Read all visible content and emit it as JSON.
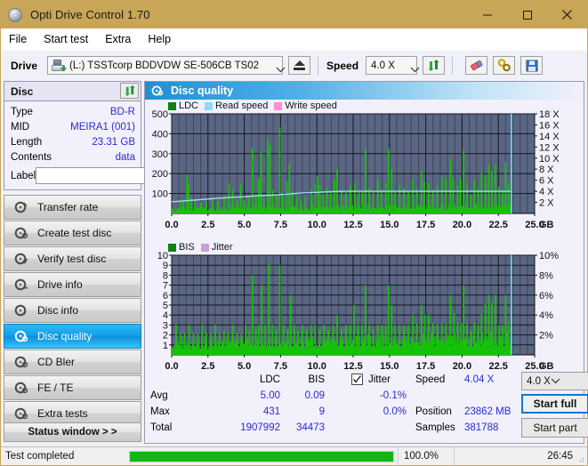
{
  "window": {
    "title": "Opti Drive Control 1.70",
    "icon": "disc-icon",
    "minimize": "−",
    "maximize": "□",
    "close": "✕"
  },
  "menu": [
    "File",
    "Start test",
    "Extra",
    "Help"
  ],
  "toolbar": {
    "drive_label": "Drive",
    "drive_value": "(L:)   TSSTcorp BDDVDW SE-506CB TS02",
    "eject_icon": "eject-icon",
    "speed_label": "Speed",
    "speed_value": "4.0 X",
    "refresh_icon": "refresh-icon",
    "erase_icon": "eraser-icon",
    "tools_icon": "tools-icon",
    "save_icon": "save-icon"
  },
  "disc": {
    "header": "Disc",
    "refresh_icon": "refresh-disc-icon",
    "fields": [
      {
        "key": "Type",
        "value": "BD-R"
      },
      {
        "key": "MID",
        "value": "MEIRA1 (001)"
      },
      {
        "key": "Length",
        "value": "23.31 GB"
      },
      {
        "key": "Contents",
        "value": "data"
      }
    ],
    "label_key": "Label",
    "label_value": "",
    "label_placeholder": "",
    "label_button_icon": "cd-icon"
  },
  "nav": {
    "items": [
      {
        "label": "Transfer rate",
        "icon": "disc-test-icon",
        "active": false
      },
      {
        "label": "Create test disc",
        "icon": "disc-test-icon",
        "active": false
      },
      {
        "label": "Verify test disc",
        "icon": "disc-test-icon",
        "active": false
      },
      {
        "label": "Drive info",
        "icon": "disc-test-icon",
        "active": false
      },
      {
        "label": "Disc info",
        "icon": "disc-test-icon",
        "active": false
      },
      {
        "label": "Disc quality",
        "icon": "disc-test-icon",
        "active": true
      },
      {
        "label": "CD Bler",
        "icon": "disc-test-icon",
        "active": false
      },
      {
        "label": "FE / TE",
        "icon": "disc-test-icon",
        "active": false
      },
      {
        "label": "Extra tests",
        "icon": "disc-test-icon",
        "active": false
      }
    ],
    "status_window": "Status window > >"
  },
  "panel": {
    "title": "Disc quality",
    "icon": "disc-quality-icon"
  },
  "stats": {
    "col_ldc": "LDC",
    "col_bis": "BIS",
    "jitter_label": "Jitter",
    "jitter_checked": true,
    "rows": [
      {
        "name": "Avg",
        "ldc": "5.00",
        "bis": "0.09",
        "jitter": "-0.1%"
      },
      {
        "name": "Max",
        "ldc": "431",
        "bis": "9",
        "jitter": "0.0%"
      },
      {
        "name": "Total",
        "ldc": "1907992",
        "bis": "34473",
        "jitter": ""
      }
    ],
    "speed_key": "Speed",
    "speed_val": "4.04 X",
    "position_key": "Position",
    "position_val": "23862 MB",
    "samples_key": "Samples",
    "samples_val": "381788",
    "speed_select": "4.0 X",
    "start_full": "Start full",
    "start_part": "Start part"
  },
  "statusbar": {
    "text": "Test completed",
    "percent_label": "100.0%",
    "percent_value": 100,
    "time": "26:45"
  },
  "colors": {
    "title_bar": "#c8a557",
    "accent_blue": "#1277d4",
    "chart_bg": "#5a6684",
    "ldc_green": "#16c209",
    "read_speed": "#8fd8f7",
    "write_speed": "#f48fd8",
    "jitter": "#c8a0d8",
    "progress_green": "#12b512",
    "value_blue": "#2b2bd0",
    "nav_active": "#14a0e8"
  },
  "chart_data": [
    {
      "type": "bar",
      "name": "ldc-chart",
      "title": "",
      "xlabel": "GB",
      "ylabel": "",
      "xlim": [
        0,
        25
      ],
      "ylim": [
        0,
        500
      ],
      "xticks": [
        "0.0",
        "2.5",
        "5.0",
        "7.5",
        "10.0",
        "12.5",
        "15.0",
        "17.5",
        "20.0",
        "22.5",
        "25.0"
      ],
      "yticks": [
        100,
        200,
        300,
        400,
        500
      ],
      "y2lim": [
        0,
        18
      ],
      "y2ticks": [
        "2 X",
        "4 X",
        "6 X",
        "8 X",
        "10 X",
        "12 X",
        "14 X",
        "16 X",
        "18 X"
      ],
      "grid": true,
      "legend": [
        {
          "label": "LDC",
          "color": "#108010"
        },
        {
          "label": "Read speed",
          "color": "#8fd8f7"
        },
        {
          "label": "Write speed",
          "color": "#f48fd8"
        }
      ],
      "data_end_gb": 23.4,
      "baseline": 30,
      "spikes": [
        [
          0.55,
          60
        ],
        [
          0.8,
          70
        ],
        [
          1.05,
          195
        ],
        [
          1.15,
          150
        ],
        [
          1.35,
          80
        ],
        [
          1.6,
          65
        ],
        [
          2.0,
          55
        ],
        [
          2.4,
          60
        ],
        [
          2.8,
          70
        ],
        [
          3.2,
          62
        ],
        [
          3.6,
          88
        ],
        [
          3.95,
          150
        ],
        [
          4.2,
          120
        ],
        [
          4.5,
          72
        ],
        [
          4.75,
          150
        ],
        [
          5.0,
          70
        ],
        [
          5.3,
          85
        ],
        [
          5.55,
          330
        ],
        [
          5.8,
          95
        ],
        [
          6.0,
          175
        ],
        [
          6.15,
          305
        ],
        [
          6.35,
          80
        ],
        [
          6.6,
          380
        ],
        [
          6.75,
          345
        ],
        [
          6.95,
          120
        ],
        [
          7.25,
          95
        ],
        [
          7.45,
          432
        ],
        [
          7.6,
          105
        ],
        [
          7.95,
          160
        ],
        [
          8.1,
          252
        ],
        [
          8.3,
          110
        ],
        [
          8.6,
          95
        ],
        [
          8.9,
          70
        ],
        [
          9.2,
          78
        ],
        [
          9.6,
          120
        ],
        [
          9.9,
          150
        ],
        [
          10.05,
          188
        ],
        [
          10.2,
          142
        ],
        [
          10.45,
          100
        ],
        [
          10.7,
          130
        ],
        [
          10.95,
          112
        ],
        [
          11.2,
          170
        ],
        [
          11.4,
          225
        ],
        [
          11.7,
          120
        ],
        [
          12.0,
          105
        ],
        [
          12.3,
          140
        ],
        [
          12.6,
          152
        ],
        [
          12.9,
          105
        ],
        [
          13.15,
          118
        ],
        [
          13.35,
          322
        ],
        [
          13.6,
          128
        ],
        [
          13.9,
          105
        ],
        [
          14.2,
          175
        ],
        [
          14.45,
          120
        ],
        [
          14.75,
          150
        ],
        [
          14.95,
          325
        ],
        [
          15.15,
          222
        ],
        [
          15.4,
          112
        ],
        [
          15.7,
          140
        ],
        [
          16.0,
          128
        ],
        [
          16.3,
          112
        ],
        [
          16.6,
          172
        ],
        [
          16.9,
          125
        ],
        [
          17.2,
          215
        ],
        [
          17.4,
          160
        ],
        [
          17.7,
          150
        ],
        [
          18.0,
          120
        ],
        [
          18.3,
          140
        ],
        [
          18.6,
          188
        ],
        [
          18.9,
          178
        ],
        [
          19.2,
          270
        ],
        [
          19.4,
          182
        ],
        [
          19.7,
          140
        ],
        [
          19.9,
          172
        ],
        [
          20.1,
          318
        ],
        [
          20.35,
          145
        ],
        [
          20.6,
          95
        ],
        [
          20.85,
          172
        ],
        [
          21.1,
          126
        ],
        [
          21.35,
          205
        ],
        [
          21.6,
          190
        ],
        [
          21.85,
          245
        ],
        [
          22.05,
          212
        ],
        [
          22.3,
          248
        ],
        [
          22.55,
          135
        ],
        [
          22.8,
          120
        ],
        [
          23.0,
          258
        ],
        [
          23.2,
          150
        ]
      ],
      "read_speed_line": [
        [
          0.0,
          2.1
        ],
        [
          1.0,
          2.3
        ],
        [
          2.0,
          2.5
        ],
        [
          3.0,
          2.7
        ],
        [
          4.0,
          2.9
        ],
        [
          5.0,
          3.0
        ],
        [
          6.0,
          3.2
        ],
        [
          7.0,
          3.3
        ],
        [
          8.0,
          3.5
        ],
        [
          9.0,
          3.7
        ],
        [
          10.0,
          3.8
        ],
        [
          11.0,
          3.95
        ],
        [
          12.0,
          4.0
        ],
        [
          14.0,
          4.0
        ],
        [
          18.0,
          4.0
        ],
        [
          23.4,
          4.0
        ]
      ],
      "end_marker_gb": 23.4
    },
    {
      "type": "bar",
      "name": "bis-chart",
      "title": "",
      "xlabel": "GB",
      "ylabel": "",
      "xlim": [
        0,
        25
      ],
      "ylim": [
        0,
        10
      ],
      "xticks": [
        "0.0",
        "2.5",
        "5.0",
        "7.5",
        "10.0",
        "12.5",
        "15.0",
        "17.5",
        "20.0",
        "22.5",
        "25.0"
      ],
      "yticks": [
        1,
        2,
        3,
        4,
        5,
        6,
        7,
        8,
        9,
        10
      ],
      "y2lim": [
        0,
        10
      ],
      "y2ticks": [
        "2%",
        "4%",
        "6%",
        "8%",
        "10%"
      ],
      "grid": true,
      "legend": [
        {
          "label": "BIS",
          "color": "#108010"
        },
        {
          "label": "Jitter",
          "color": "#c8a0d8"
        }
      ],
      "data_end_gb": 23.4,
      "baseline": 1.4,
      "spikes": [
        [
          0.3,
          3.0
        ],
        [
          0.6,
          2.1
        ],
        [
          0.9,
          2.2
        ],
        [
          1.2,
          3.0
        ],
        [
          1.5,
          2.2
        ],
        [
          1.8,
          2.1
        ],
        [
          2.1,
          3.0
        ],
        [
          2.4,
          2.2
        ],
        [
          2.7,
          2.1
        ],
        [
          3.0,
          3.0
        ],
        [
          3.3,
          2.2
        ],
        [
          3.6,
          2.4
        ],
        [
          3.9,
          2.2
        ],
        [
          4.2,
          3.0
        ],
        [
          4.5,
          2.2
        ],
        [
          4.8,
          2.1
        ],
        [
          5.1,
          3.0
        ],
        [
          5.35,
          2.4
        ],
        [
          5.55,
          8.0
        ],
        [
          5.8,
          2.6
        ],
        [
          6.0,
          3.0
        ],
        [
          6.2,
          7.0
        ],
        [
          6.45,
          3.0
        ],
        [
          6.7,
          9.1
        ],
        [
          6.95,
          3.0
        ],
        [
          7.2,
          2.5
        ],
        [
          7.45,
          9.0
        ],
        [
          7.7,
          3.0
        ],
        [
          8.0,
          2.6
        ],
        [
          8.2,
          6.0
        ],
        [
          8.45,
          3.0
        ],
        [
          8.7,
          2.4
        ],
        [
          9.0,
          3.0
        ],
        [
          9.3,
          2.5
        ],
        [
          9.6,
          3.0
        ],
        [
          9.9,
          3.0
        ],
        [
          10.2,
          2.6
        ],
        [
          10.5,
          3.0
        ],
        [
          10.8,
          2.5
        ],
        [
          11.1,
          3.0
        ],
        [
          11.4,
          4.0
        ],
        [
          11.7,
          2.6
        ],
        [
          12.0,
          3.0
        ],
        [
          12.3,
          3.0
        ],
        [
          12.55,
          5.0
        ],
        [
          12.85,
          3.0
        ],
        [
          13.1,
          3.0
        ],
        [
          13.35,
          7.0
        ],
        [
          13.6,
          3.0
        ],
        [
          13.9,
          2.6
        ],
        [
          14.2,
          3.0
        ],
        [
          14.5,
          3.0
        ],
        [
          14.75,
          3.0
        ],
        [
          14.95,
          7.0
        ],
        [
          15.15,
          5.0
        ],
        [
          15.4,
          3.0
        ],
        [
          15.7,
          3.0
        ],
        [
          16.0,
          3.0
        ],
        [
          16.3,
          3.0
        ],
        [
          16.6,
          4.0
        ],
        [
          16.9,
          3.2
        ],
        [
          17.2,
          5.0
        ],
        [
          17.45,
          4.0
        ],
        [
          17.7,
          4.0
        ],
        [
          18.0,
          3.2
        ],
        [
          18.3,
          3.1
        ],
        [
          18.6,
          3.2
        ],
        [
          18.9,
          3.1
        ],
        [
          19.2,
          6.0
        ],
        [
          19.45,
          4.2
        ],
        [
          19.7,
          3.2
        ],
        [
          19.95,
          3.2
        ],
        [
          20.1,
          7.0
        ],
        [
          20.35,
          3.1
        ],
        [
          20.6,
          2.4
        ],
        [
          20.85,
          3.2
        ],
        [
          21.1,
          3.0
        ],
        [
          21.35,
          4.1
        ],
        [
          21.6,
          5.1
        ],
        [
          21.85,
          6.0
        ],
        [
          22.05,
          5.2
        ],
        [
          22.3,
          6.0
        ],
        [
          22.55,
          3.0
        ],
        [
          22.8,
          3.0
        ],
        [
          23.0,
          6.0
        ],
        [
          23.2,
          3.2
        ]
      ],
      "end_marker_gb": 23.4
    }
  ]
}
